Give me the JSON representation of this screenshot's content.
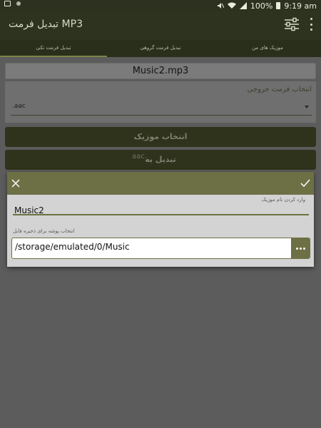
{
  "status_bar": {
    "battery": "100%",
    "time": "9:19 am"
  },
  "toolbar": {
    "title": "تبدیل فرمت MP3"
  },
  "tabs": [
    {
      "label": "موزیک های من"
    },
    {
      "label": "تبدیل فرمت گروهی"
    },
    {
      "label": "تبدیل فرمت تکی",
      "active": true
    }
  ],
  "main": {
    "file_name": "Music2.mp3",
    "format_label": "انتخاب فرمت خروجی",
    "format_value": ".aac",
    "select_music_label": "انتخاب موزیک",
    "convert_label": "تبدیل به",
    "convert_format": "aac."
  },
  "dialog": {
    "name_label": "وارد کردن نام موزیک",
    "name_value": "Music2",
    "folder_label": "انتخاب پوشه برای ذخیره فایل",
    "path_value": "/storage/emulated/0/Music"
  },
  "colors": {
    "accent": "#6d7044",
    "toolbar": "#2e331f",
    "dialog_bg": "#d3d3d3"
  },
  "icons": [
    "close-icon",
    "check-icon",
    "sliders-icon",
    "overflow-menu-icon",
    "more-icon",
    "wifi-icon",
    "signal-icon",
    "battery-icon",
    "mute-icon",
    "screenshot-icon"
  ]
}
